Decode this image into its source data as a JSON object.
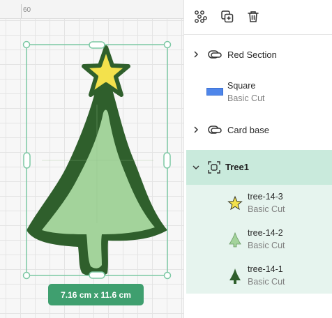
{
  "canvas": {
    "ruler_value": "60",
    "dimensions_label": "7.16  cm x 11.6  cm"
  },
  "toolbar": {
    "buttons": [
      "group-icon",
      "duplicate-icon",
      "delete-icon"
    ]
  },
  "layers": {
    "red_section": {
      "label": "Red Section",
      "icon": "group-icon"
    },
    "square": {
      "title": "Square",
      "subtitle": "Basic Cut",
      "color": "#4f86ea"
    },
    "card_base": {
      "label": "Card base",
      "icon": "group-icon"
    },
    "tree1": {
      "label": "Tree1",
      "expanded": true,
      "children": [
        {
          "title": "tree-14-3",
          "subtitle": "Basic Cut",
          "icon": "star-icon"
        },
        {
          "title": "tree-14-2",
          "subtitle": "Basic Cut",
          "icon": "tree-light-icon"
        },
        {
          "title": "tree-14-1",
          "subtitle": "Basic Cut",
          "icon": "tree-dark-icon"
        }
      ]
    }
  },
  "colors": {
    "accent": "#3f9f6f",
    "selection": "#7cc8a4",
    "tree_dark": "#2f5f2c",
    "tree_light": "#a3d39b",
    "star": "#f3e14c",
    "highlight_row": "#c9eadc"
  }
}
